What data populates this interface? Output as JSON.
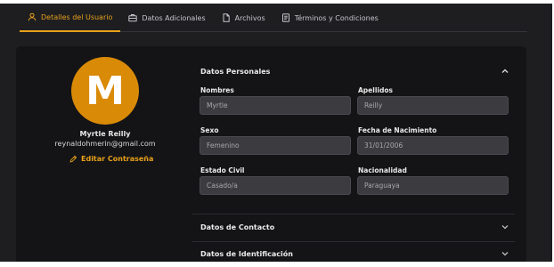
{
  "tabs": [
    {
      "label": "Detalles del Usuario",
      "icon": "user-icon",
      "active": true
    },
    {
      "label": "Datos Adicionales",
      "icon": "briefcase-icon",
      "active": false
    },
    {
      "label": "Archivos",
      "icon": "file-icon",
      "active": false
    },
    {
      "label": "Términos y Condiciones",
      "icon": "document-icon",
      "active": false
    }
  ],
  "profile": {
    "initial": "M",
    "name": "Myrtle Reilly",
    "email": "reynaldohmerin@gmail.com",
    "edit_password": "Editar Contraseña"
  },
  "personal": {
    "title": "Datos Personales",
    "fields": {
      "nombres": {
        "label": "Nombres",
        "value": "Myrtle"
      },
      "apellidos": {
        "label": "Apellidos",
        "value": "Reilly"
      },
      "sexo": {
        "label": "Sexo",
        "value": "Femenino"
      },
      "fecha": {
        "label": "Fecha de Nacimiento",
        "value": "31/01/2006"
      },
      "estado": {
        "label": "Estado Civil",
        "value": "Casado/a"
      },
      "nacionalidad": {
        "label": "Nacionalidad",
        "value": "Paraguaya"
      }
    }
  },
  "sections": {
    "contacto": "Datos de Contacto",
    "identificacion": "Datos de Identificación"
  },
  "colors": {
    "accent": "#e8a01a",
    "avatar": "#d98a07",
    "panel": "#141416",
    "background": "#1e1e21",
    "field": "#3b3b40"
  }
}
